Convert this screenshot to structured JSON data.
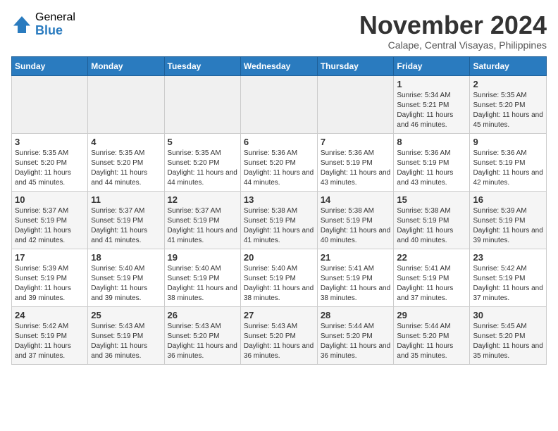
{
  "header": {
    "logo_general": "General",
    "logo_blue": "Blue",
    "month_title": "November 2024",
    "location": "Calape, Central Visayas, Philippines"
  },
  "weekdays": [
    "Sunday",
    "Monday",
    "Tuesday",
    "Wednesday",
    "Thursday",
    "Friday",
    "Saturday"
  ],
  "weeks": [
    [
      {
        "day": "",
        "info": ""
      },
      {
        "day": "",
        "info": ""
      },
      {
        "day": "",
        "info": ""
      },
      {
        "day": "",
        "info": ""
      },
      {
        "day": "",
        "info": ""
      },
      {
        "day": "1",
        "info": "Sunrise: 5:34 AM\nSunset: 5:21 PM\nDaylight: 11 hours and 46 minutes."
      },
      {
        "day": "2",
        "info": "Sunrise: 5:35 AM\nSunset: 5:20 PM\nDaylight: 11 hours and 45 minutes."
      }
    ],
    [
      {
        "day": "3",
        "info": "Sunrise: 5:35 AM\nSunset: 5:20 PM\nDaylight: 11 hours and 45 minutes."
      },
      {
        "day": "4",
        "info": "Sunrise: 5:35 AM\nSunset: 5:20 PM\nDaylight: 11 hours and 44 minutes."
      },
      {
        "day": "5",
        "info": "Sunrise: 5:35 AM\nSunset: 5:20 PM\nDaylight: 11 hours and 44 minutes."
      },
      {
        "day": "6",
        "info": "Sunrise: 5:36 AM\nSunset: 5:20 PM\nDaylight: 11 hours and 44 minutes."
      },
      {
        "day": "7",
        "info": "Sunrise: 5:36 AM\nSunset: 5:19 PM\nDaylight: 11 hours and 43 minutes."
      },
      {
        "day": "8",
        "info": "Sunrise: 5:36 AM\nSunset: 5:19 PM\nDaylight: 11 hours and 43 minutes."
      },
      {
        "day": "9",
        "info": "Sunrise: 5:36 AM\nSunset: 5:19 PM\nDaylight: 11 hours and 42 minutes."
      }
    ],
    [
      {
        "day": "10",
        "info": "Sunrise: 5:37 AM\nSunset: 5:19 PM\nDaylight: 11 hours and 42 minutes."
      },
      {
        "day": "11",
        "info": "Sunrise: 5:37 AM\nSunset: 5:19 PM\nDaylight: 11 hours and 41 minutes."
      },
      {
        "day": "12",
        "info": "Sunrise: 5:37 AM\nSunset: 5:19 PM\nDaylight: 11 hours and 41 minutes."
      },
      {
        "day": "13",
        "info": "Sunrise: 5:38 AM\nSunset: 5:19 PM\nDaylight: 11 hours and 41 minutes."
      },
      {
        "day": "14",
        "info": "Sunrise: 5:38 AM\nSunset: 5:19 PM\nDaylight: 11 hours and 40 minutes."
      },
      {
        "day": "15",
        "info": "Sunrise: 5:38 AM\nSunset: 5:19 PM\nDaylight: 11 hours and 40 minutes."
      },
      {
        "day": "16",
        "info": "Sunrise: 5:39 AM\nSunset: 5:19 PM\nDaylight: 11 hours and 39 minutes."
      }
    ],
    [
      {
        "day": "17",
        "info": "Sunrise: 5:39 AM\nSunset: 5:19 PM\nDaylight: 11 hours and 39 minutes."
      },
      {
        "day": "18",
        "info": "Sunrise: 5:40 AM\nSunset: 5:19 PM\nDaylight: 11 hours and 39 minutes."
      },
      {
        "day": "19",
        "info": "Sunrise: 5:40 AM\nSunset: 5:19 PM\nDaylight: 11 hours and 38 minutes."
      },
      {
        "day": "20",
        "info": "Sunrise: 5:40 AM\nSunset: 5:19 PM\nDaylight: 11 hours and 38 minutes."
      },
      {
        "day": "21",
        "info": "Sunrise: 5:41 AM\nSunset: 5:19 PM\nDaylight: 11 hours and 38 minutes."
      },
      {
        "day": "22",
        "info": "Sunrise: 5:41 AM\nSunset: 5:19 PM\nDaylight: 11 hours and 37 minutes."
      },
      {
        "day": "23",
        "info": "Sunrise: 5:42 AM\nSunset: 5:19 PM\nDaylight: 11 hours and 37 minutes."
      }
    ],
    [
      {
        "day": "24",
        "info": "Sunrise: 5:42 AM\nSunset: 5:19 PM\nDaylight: 11 hours and 37 minutes."
      },
      {
        "day": "25",
        "info": "Sunrise: 5:43 AM\nSunset: 5:19 PM\nDaylight: 11 hours and 36 minutes."
      },
      {
        "day": "26",
        "info": "Sunrise: 5:43 AM\nSunset: 5:20 PM\nDaylight: 11 hours and 36 minutes."
      },
      {
        "day": "27",
        "info": "Sunrise: 5:43 AM\nSunset: 5:20 PM\nDaylight: 11 hours and 36 minutes."
      },
      {
        "day": "28",
        "info": "Sunrise: 5:44 AM\nSunset: 5:20 PM\nDaylight: 11 hours and 36 minutes."
      },
      {
        "day": "29",
        "info": "Sunrise: 5:44 AM\nSunset: 5:20 PM\nDaylight: 11 hours and 35 minutes."
      },
      {
        "day": "30",
        "info": "Sunrise: 5:45 AM\nSunset: 5:20 PM\nDaylight: 11 hours and 35 minutes."
      }
    ]
  ]
}
